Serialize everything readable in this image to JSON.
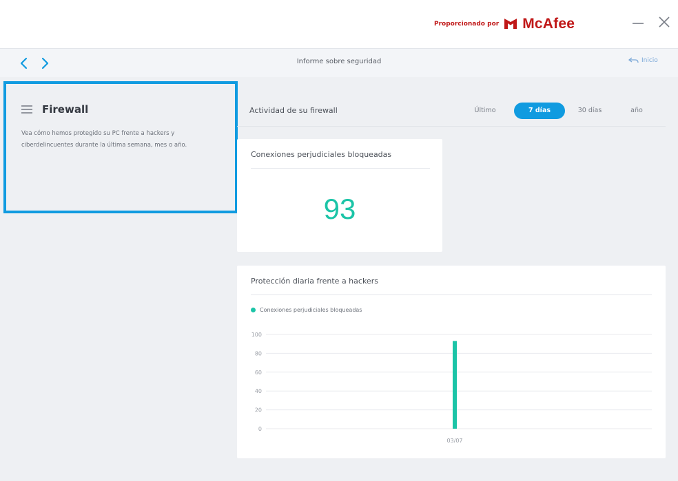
{
  "titlebar": {
    "provided_by": "Proporcionado por",
    "brand_name": "McAfee",
    "minimize_icon": "minimize-icon",
    "close_icon": "close-icon"
  },
  "navbar": {
    "title": "Informe sobre seguridad",
    "home_label": "Inicio"
  },
  "left_panel": {
    "title": "Firewall",
    "description": "Vea cómo hemos protegido su PC frente a hackers y ciberdelincuentes durante la última semana, mes o año."
  },
  "activity": {
    "label": "Actividad de su firewall",
    "tabs": [
      {
        "label": "Último",
        "selected": false
      },
      {
        "label": "7 días",
        "selected": true
      },
      {
        "label": "30 días",
        "selected": false
      },
      {
        "label": "año",
        "selected": false
      }
    ]
  },
  "blocked_card": {
    "title": "Conexiones perjudiciales bloqueadas",
    "count": "93"
  },
  "chart_card": {
    "title": "Protección diaria frente a hackers"
  },
  "colors": {
    "accent": "#109be0",
    "series": "#1bc4a7",
    "brand": "#c01818"
  },
  "chart_data": {
    "type": "bar",
    "categories": [
      "03/07"
    ],
    "series": [
      {
        "name": "Conexiones perjudiciales bloqueadas",
        "values": [
          93
        ]
      }
    ],
    "yticks": [
      0,
      20,
      40,
      60,
      80,
      100
    ],
    "ylim": [
      0,
      100
    ],
    "grid": true,
    "legend": "top-left"
  }
}
